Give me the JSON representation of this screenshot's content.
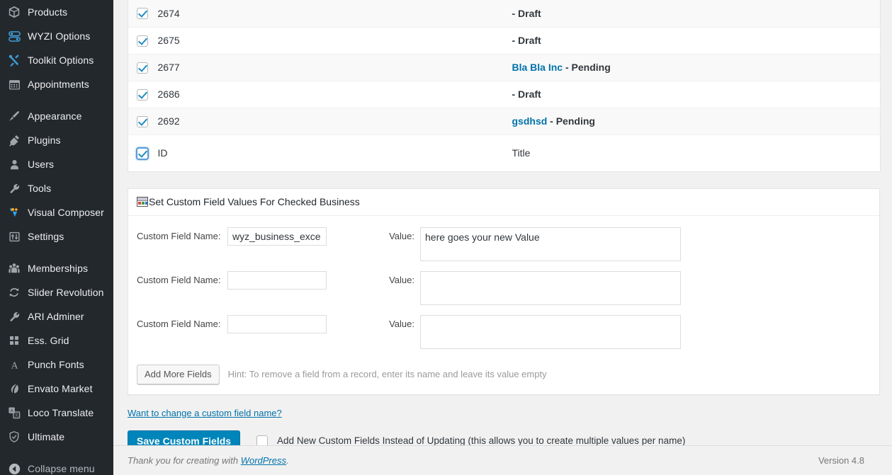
{
  "sidebar": {
    "items": [
      {
        "label": "Products",
        "icon": "box-icon",
        "name": "sidebar-item-products"
      },
      {
        "label": "WYZI Options",
        "icon": "toggles-icon",
        "name": "sidebar-item-wyzi-options"
      },
      {
        "label": "Toolkit Options",
        "icon": "tools-cross-icon",
        "name": "sidebar-item-toolkit-options"
      },
      {
        "label": "Appointments",
        "icon": "calendar-icon",
        "name": "sidebar-item-appointments"
      },
      {
        "separator": true
      },
      {
        "label": "Appearance",
        "icon": "paintbrush-icon",
        "name": "sidebar-item-appearance"
      },
      {
        "label": "Plugins",
        "icon": "plug-icon",
        "name": "sidebar-item-plugins"
      },
      {
        "label": "Users",
        "icon": "user-icon",
        "name": "sidebar-item-users"
      },
      {
        "label": "Tools",
        "icon": "wrench-icon",
        "name": "sidebar-item-tools"
      },
      {
        "label": "Visual Composer",
        "icon": "visual-composer-icon",
        "name": "sidebar-item-visual-composer"
      },
      {
        "label": "Settings",
        "icon": "sliders-icon",
        "name": "sidebar-item-settings"
      },
      {
        "separator": true
      },
      {
        "label": "Memberships",
        "icon": "group-icon",
        "name": "sidebar-item-memberships"
      },
      {
        "label": "Slider Revolution",
        "icon": "refresh-icon",
        "name": "sidebar-item-slider-revolution"
      },
      {
        "label": "ARI Adminer",
        "icon": "wrench-icon",
        "name": "sidebar-item-ari-adminer"
      },
      {
        "label": "Ess. Grid",
        "icon": "grid-icon",
        "name": "sidebar-item-ess-grid"
      },
      {
        "label": "Punch Fonts",
        "icon": "letter-a-icon",
        "name": "sidebar-item-punch-fonts"
      },
      {
        "label": "Envato Market",
        "icon": "envato-leaf-icon",
        "name": "sidebar-item-envato-market"
      },
      {
        "label": "Loco Translate",
        "icon": "translate-icon",
        "name": "sidebar-item-loco-translate"
      },
      {
        "label": "Ultimate",
        "icon": "shield-icon",
        "name": "sidebar-item-ultimate"
      },
      {
        "separator": true
      }
    ],
    "collapse": {
      "label": "Collapse menu",
      "icon": "collapse-arrow-icon"
    }
  },
  "table": {
    "rows": [
      {
        "id": "2674",
        "link": "",
        "status": "- Draft",
        "checked": true,
        "clipped": true
      },
      {
        "id": "2675",
        "link": "",
        "status": "- Draft",
        "checked": true
      },
      {
        "id": "2677",
        "link": "Bla Bla Inc",
        "status": "- Pending",
        "checked": true
      },
      {
        "id": "2686",
        "link": "",
        "status": "- Draft",
        "checked": true
      },
      {
        "id": "2692",
        "link": "gsdhsd",
        "status": "- Pending",
        "checked": true
      }
    ],
    "footer": {
      "id_label": "ID",
      "title_label": "Title",
      "checked": true
    }
  },
  "panel": {
    "title": "Set Custom Field Values For Checked Business",
    "fields": [
      {
        "name_label": "Custom Field Name:",
        "name_value": "wyz_business_exce",
        "value_label": "Value:",
        "value_value": "here goes your new Value"
      },
      {
        "name_label": "Custom Field Name:",
        "name_value": "",
        "value_label": "Value:",
        "value_value": ""
      },
      {
        "name_label": "Custom Field Name:",
        "name_value": "",
        "value_label": "Value:",
        "value_value": ""
      }
    ],
    "add_more_label": "Add More Fields",
    "hint": "Hint: To remove a field from a record, enter its name and leave its value empty"
  },
  "actions": {
    "change_name_link": "Want to change a custom field name?",
    "save_label": "Save Custom Fields",
    "add_new_checkbox_label": "Add New Custom Fields Instead of Updating (this allows you to create multiple values per name)",
    "add_new_checked": false
  },
  "footer": {
    "thanks_prefix": "Thank you for creating with ",
    "wordpress_label": "WordPress",
    "thanks_suffix": ".",
    "version": "Version 4.8"
  },
  "colors": {
    "sidebar_bg": "#23282d",
    "accent_link": "#0073aa",
    "primary_button": "#0085ba",
    "checkbox_check": "#1e8cbe",
    "page_bg": "#f1f1f1"
  }
}
